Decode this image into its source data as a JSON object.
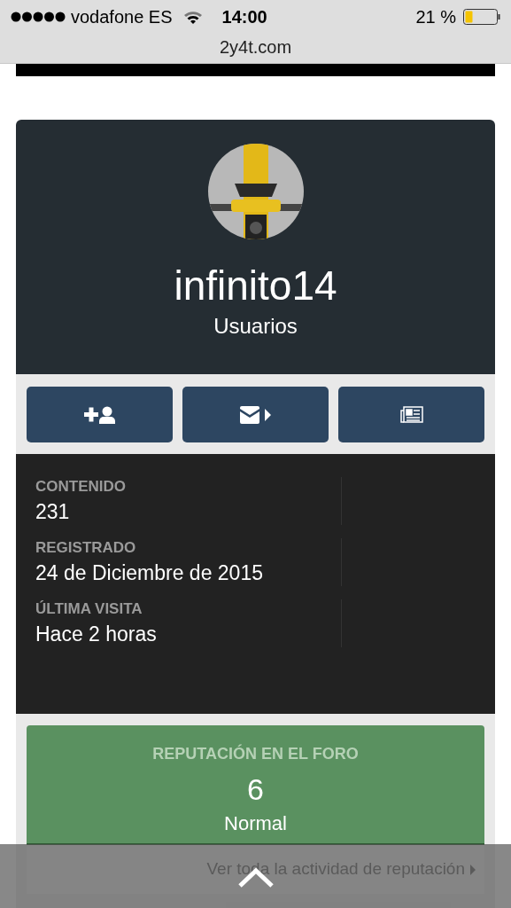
{
  "status_bar": {
    "carrier": "vodafone ES",
    "time": "14:00",
    "battery": "21 %"
  },
  "browser": {
    "url": "2y4t.com"
  },
  "profile": {
    "username": "infinito14",
    "group": "Usuarios"
  },
  "actions": [
    {
      "kind": "add-friend"
    },
    {
      "kind": "message"
    },
    {
      "kind": "activity"
    }
  ],
  "stats": [
    {
      "label": "CONTENIDO",
      "value": "231"
    },
    {
      "label": "REGISTRADO",
      "value": "24 de Diciembre de 2015"
    },
    {
      "label": "ÚLTIMA VISITA",
      "value": "Hace 2 horas"
    }
  ],
  "reputation": {
    "title": "REPUTACIÓN EN EL FORO",
    "value": "6",
    "level_name": "Normal",
    "link": "Ver toda la actividad de reputación"
  }
}
